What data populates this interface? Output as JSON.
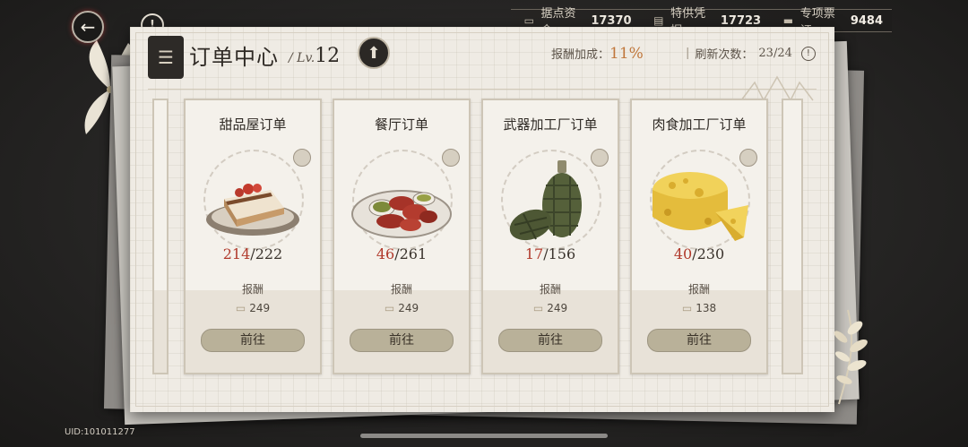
{
  "nav": {
    "back_icon": "back-arrow-icon",
    "info_icon": "info-icon",
    "info_glyph": "!"
  },
  "currencies": [
    {
      "icon": "ticket-icon",
      "label": "据点资金",
      "value": "17370"
    },
    {
      "icon": "voucher-icon",
      "label": "特供凭据",
      "value": "17723"
    },
    {
      "icon": "bill-icon",
      "label": "专项票证",
      "value": "9484"
    }
  ],
  "header": {
    "title": "订单中心",
    "level_prefix": "/ Lv.",
    "level": "12",
    "upgrade_glyph": "⬆",
    "bonus_label": "报酬加成：",
    "bonus_value": "11%",
    "refresh_label": "刷新次数：",
    "refresh_value": "23/24",
    "refresh_help": "!"
  },
  "orders": [
    {
      "name": "甜品屋订单",
      "current": "214",
      "total": "/222",
      "reward_label": "报酬",
      "reward": "249",
      "button": "前往",
      "art": "cake"
    },
    {
      "name": "餐厅订单",
      "current": "46",
      "total": "/261",
      "reward_label": "报酬",
      "reward": "249",
      "button": "前往",
      "art": "platter"
    },
    {
      "name": "武器加工厂订单",
      "current": "17",
      "total": "/156",
      "reward_label": "报酬",
      "reward": "249",
      "button": "前往",
      "art": "grenade"
    },
    {
      "name": "肉食加工厂订单",
      "current": "40",
      "total": "/230",
      "reward_label": "报酬",
      "reward": "138",
      "button": "前往",
      "art": "cheese"
    }
  ],
  "uid": "UID:101011277",
  "colors": {
    "progress_current": "#b0392b",
    "bonus": "#c0773c",
    "button": "#b9b199"
  }
}
